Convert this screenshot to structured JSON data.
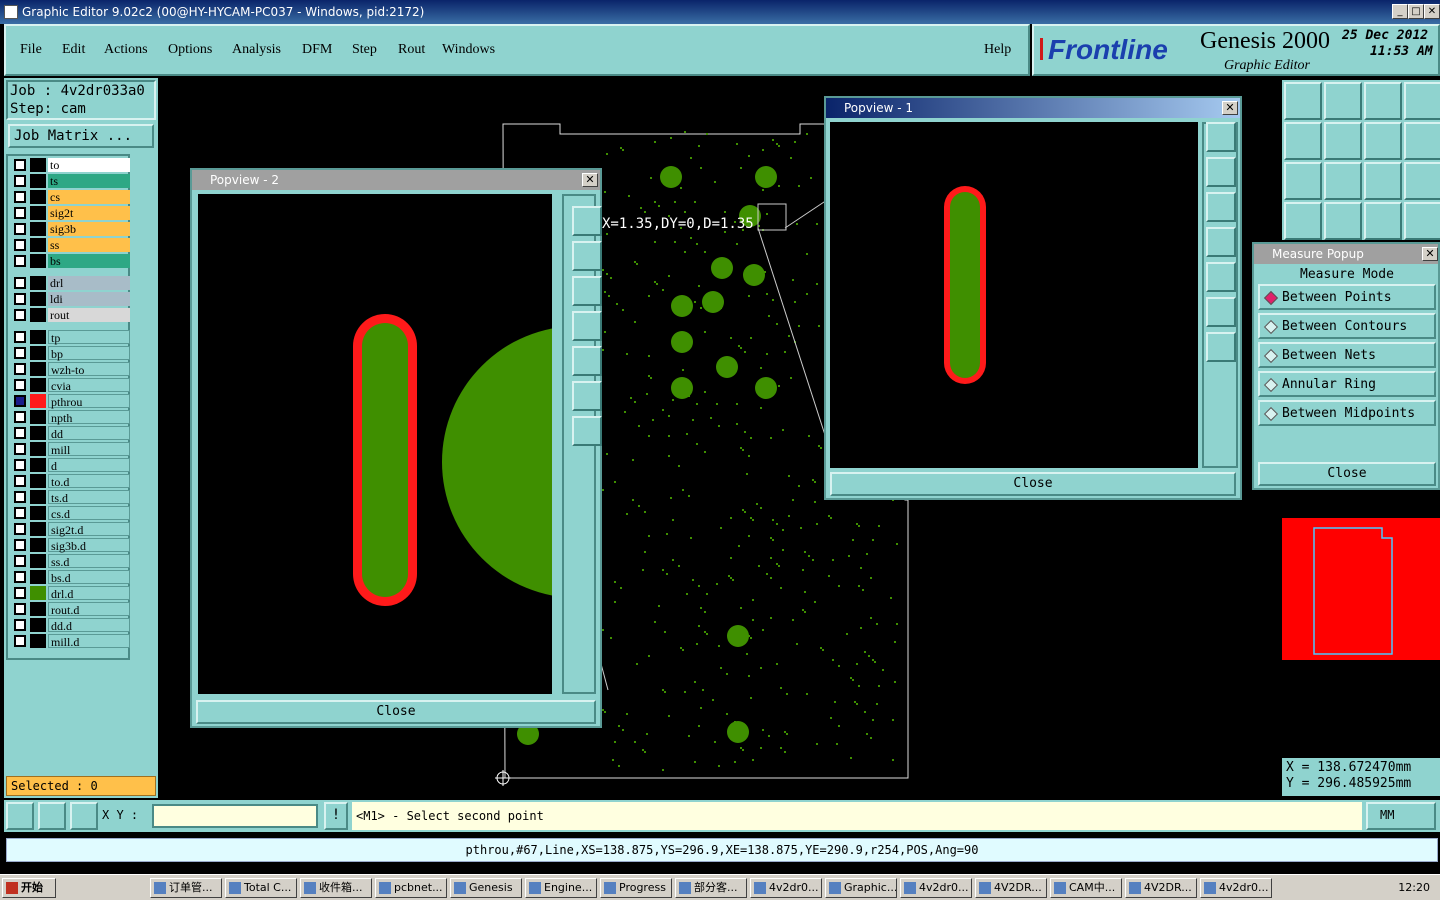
{
  "window": {
    "title": "Graphic Editor 9.02c2 (00@HY-HYCAM-PC037 - Windows, pid:2172)"
  },
  "menu": {
    "file": "File",
    "edit": "Edit",
    "actions": "Actions",
    "options": "Options",
    "analysis": "Analysis",
    "dfm": "DFM",
    "step": "Step",
    "rout": "Rout",
    "windows": "Windows",
    "help": "Help"
  },
  "logo": {
    "brand": "Frontline",
    "product": "Genesis 2000",
    "subtitle": "Graphic Editor",
    "date": "25 Dec 2012",
    "time": "11:53 AM"
  },
  "job": {
    "job_label": "Job  :  4v2dr033a0",
    "step_label": "Step:  cam",
    "matrix_button": "Job Matrix ..."
  },
  "layers": [
    "to",
    "ts",
    "cs",
    "sig2t",
    "sig3b",
    "ss",
    "bs",
    "drl",
    "ldi",
    "rout",
    "tp",
    "bp",
    "wzh-to",
    "cvia",
    "pthrou",
    "npth",
    "dd",
    "mill",
    "d",
    "to.d",
    "ts.d",
    "cs.d",
    "sig2t.d",
    "sig3b.d",
    "ss.d",
    "bs.d",
    "drl.d",
    "rout.d",
    "dd.d",
    "mill.d"
  ],
  "colors": {
    "teal": "#8fd3cf",
    "copper_green": "#3f8f00",
    "pad_red": "#ff1a1a",
    "signal_orange": "#ffc04a",
    "solder_green": "#2ea885",
    "drill_gray": "#a8bcc8"
  },
  "selected": "Selected : 0",
  "popview2": {
    "title": "Popview - 2",
    "close": "Close"
  },
  "popview1": {
    "title": "Popview - 1",
    "close": "Close"
  },
  "measure": {
    "title": "Measure Popup",
    "mode": "Measure Mode",
    "options": [
      "Between Points",
      "Between Contours",
      "Between Nets",
      "Annular Ring",
      "Between Midpoints"
    ],
    "close": "Close"
  },
  "readout": {
    "dx": "X=1.35,DY=0,D=1.35",
    "x": "X  =  138.672470mm",
    "y": "Y  =  296.485925mm"
  },
  "bottom": {
    "xy_label": "X Y :",
    "xy_value": "",
    "prompt": "<M1> - Select second point",
    "units": "MM",
    "status": "pthrou,#67,Line,XS=138.875,YS=296.9,XE=138.875,YE=290.9,r254,POS,Ang=90"
  },
  "taskbar": {
    "start": "开始",
    "clock": "12:20",
    "items": [
      "订单管...",
      "Total C...",
      "收件箱...",
      "pcbnet...",
      "Genesis",
      "Engine...",
      "Progress",
      "部分客...",
      "4v2dr0...",
      "Graphic...",
      "4v2dr0...",
      "4V2DR...",
      "CAM中...",
      "4V2DR...",
      "4v2dr0..."
    ]
  }
}
